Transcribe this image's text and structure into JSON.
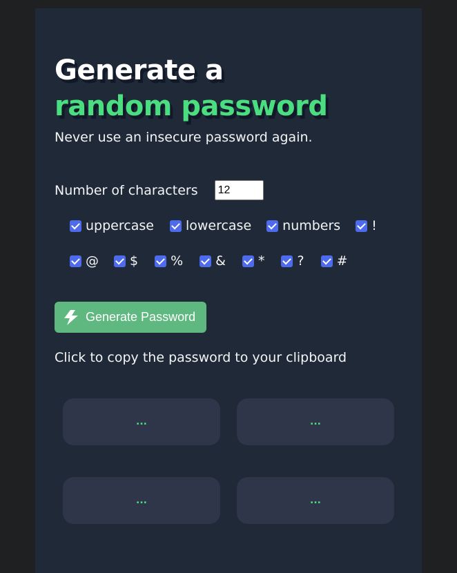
{
  "header": {
    "title_line1": "Generate a",
    "title_line2": "random password",
    "subtitle": "Never use an insecure password again."
  },
  "length": {
    "label": "Number of characters",
    "value": "12"
  },
  "options": {
    "row1": [
      {
        "label": "uppercase",
        "checked": true
      },
      {
        "label": "lowercase",
        "checked": true
      },
      {
        "label": "numbers",
        "checked": true
      },
      {
        "label": "!",
        "checked": true
      }
    ],
    "row2": [
      {
        "label": "@",
        "checked": true
      },
      {
        "label": "$",
        "checked": true
      },
      {
        "label": "%",
        "checked": true
      },
      {
        "label": "&",
        "checked": true
      },
      {
        "label": "*",
        "checked": true
      },
      {
        "label": "?",
        "checked": true
      },
      {
        "label": "#",
        "checked": true
      }
    ]
  },
  "generate_button": {
    "label": "Generate Password",
    "icon": "lightning-icon"
  },
  "copy_hint": "Click to copy the password to your clipboard",
  "passwords": [
    "...",
    "...",
    "...",
    "..."
  ],
  "colors": {
    "background": "#1f2022",
    "card": "#1f2937",
    "accent": "#4ade80",
    "button": "#5eb87f",
    "checkbox": "#4f6bed",
    "password_box": "#2f3649"
  }
}
